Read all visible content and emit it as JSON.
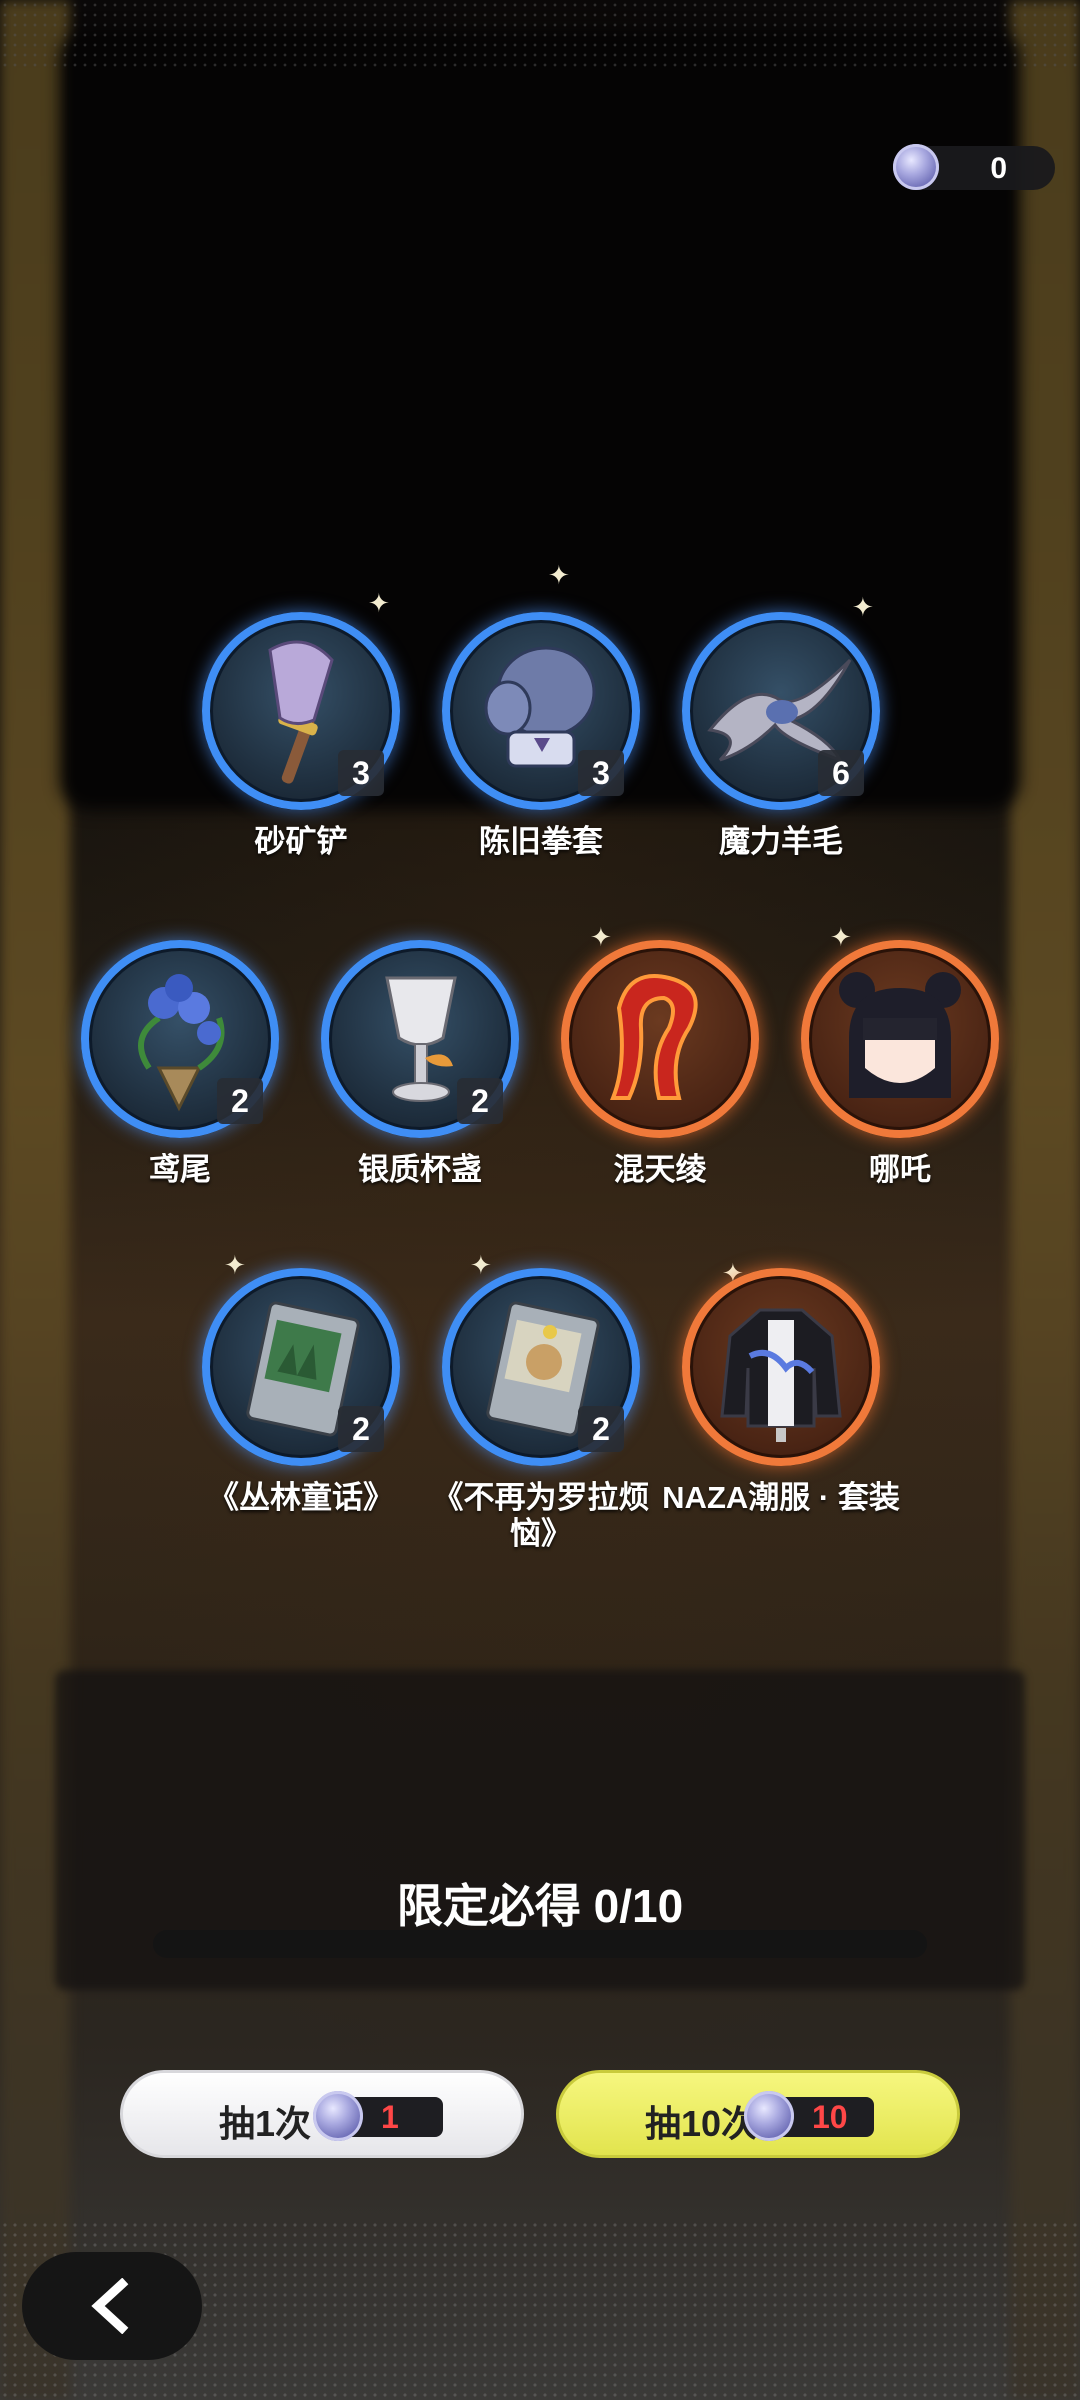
{
  "currency": {
    "amount": "0",
    "icon": "crystal-coin-icon"
  },
  "items": [
    {
      "name": "砂矿铲",
      "count": "3",
      "rarity": "blue",
      "icon": "shovel-icon"
    },
    {
      "name": "陈旧拳套",
      "count": "3",
      "rarity": "blue",
      "icon": "boxing-glove-icon"
    },
    {
      "name": "魔力羊毛",
      "count": "6",
      "rarity": "blue",
      "icon": "wool-bundle-icon"
    },
    {
      "name": "鸢尾",
      "count": "2",
      "rarity": "blue",
      "icon": "iris-bouquet-icon"
    },
    {
      "name": "银质杯盏",
      "count": "2",
      "rarity": "blue",
      "icon": "silver-goblet-icon"
    },
    {
      "name": "混天绫",
      "count": "",
      "rarity": "orange",
      "icon": "red-sash-icon"
    },
    {
      "name": "哪吒",
      "count": "",
      "rarity": "orange",
      "icon": "character-portrait-icon"
    },
    {
      "name": "《丛林童话》",
      "count": "2",
      "rarity": "blue",
      "icon": "jungle-book-icon"
    },
    {
      "name": "《不再为罗拉烦恼》",
      "count": "2",
      "rarity": "blue",
      "icon": "money-bag-book-icon"
    },
    {
      "name": "NAZA潮服 · 套装",
      "count": "",
      "rarity": "orange",
      "icon": "jacket-outfit-icon"
    }
  ],
  "guarantee": {
    "label": "限定必得 0/10",
    "progress": 0
  },
  "buttons": {
    "draw_one": {
      "label": "抽1次",
      "cost": "1"
    },
    "draw_ten": {
      "label": "抽10次",
      "cost": "10"
    }
  },
  "colors": {
    "blue_ring": "#3f8ef5",
    "orange_ring": "#f0793a",
    "cost_text": "#ff4747",
    "ten_button": "#e9eb5c"
  }
}
